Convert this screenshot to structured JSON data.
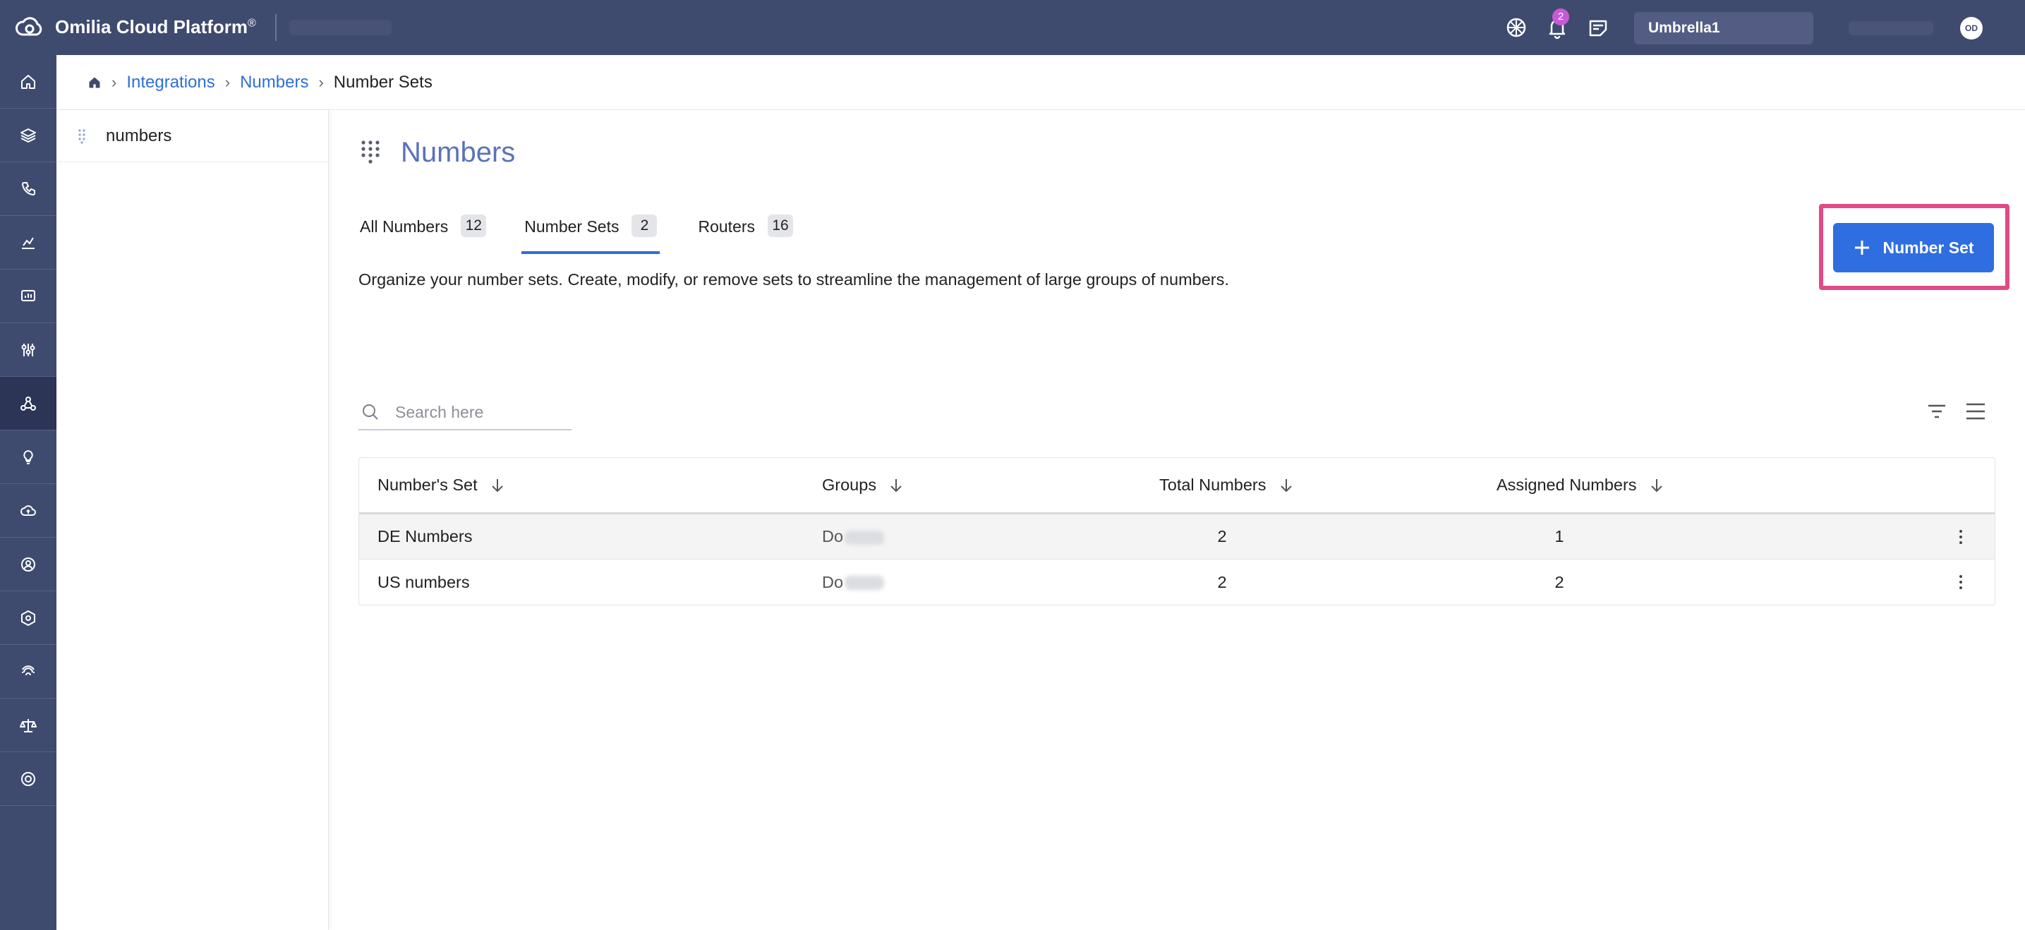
{
  "app": {
    "brand": "Omilia Cloud Platform",
    "brand_mark": "®",
    "org": "Umbrella1",
    "notifications_count": "2",
    "user_initials": "OD"
  },
  "rail": {
    "items": [
      "home-icon",
      "layers-icon",
      "phone-icon",
      "analytics-icon",
      "dashboard-icon",
      "sliders-icon",
      "integrations-icon",
      "idea-icon",
      "cloud-icon",
      "user-circle-icon",
      "hexagon-icon",
      "fingerprint-icon",
      "balance-icon",
      "globe-icon"
    ],
    "active_index": 6
  },
  "breadcrumb": {
    "items": [
      "Integrations",
      "Numbers"
    ],
    "current": "Number Sets"
  },
  "sidebar": {
    "items": [
      {
        "label": "numbers"
      }
    ]
  },
  "page": {
    "title": "Numbers",
    "description": "Organize your number sets. Create, modify, or remove sets to streamline the management of large groups of numbers.",
    "add_button_label": "Number Set"
  },
  "tabs": [
    {
      "label": "All Numbers",
      "count": "12"
    },
    {
      "label": "Number Sets",
      "count": "2"
    },
    {
      "label": "Routers",
      "count": "16"
    }
  ],
  "search": {
    "placeholder": "Search here"
  },
  "table": {
    "headers": [
      "Number's Set",
      "Groups",
      "Total Numbers",
      "Assigned Numbers"
    ],
    "rows": [
      {
        "set": "DE Numbers",
        "group": "Do",
        "total": "2",
        "assigned": "1"
      },
      {
        "set": "US numbers",
        "group": "Do",
        "total": "2",
        "assigned": "2"
      }
    ]
  },
  "colors": {
    "topbar": "#3f4a6f",
    "accent": "#2f6ee0",
    "highlight": "#e04a86",
    "title": "#5a72b8"
  }
}
